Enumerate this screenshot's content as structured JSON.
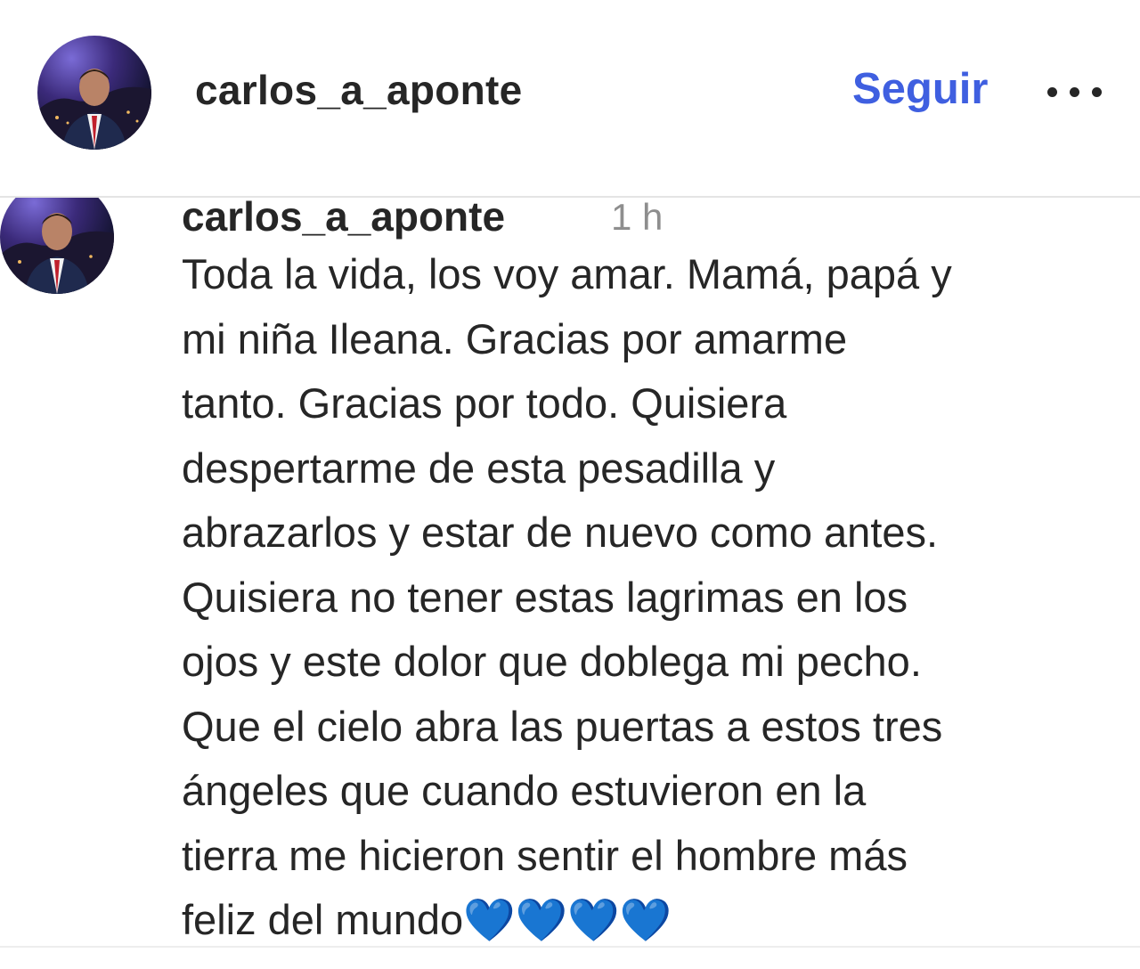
{
  "post_header": {
    "username": "carlos_a_aponte",
    "follow_label": "Seguir",
    "more_icon": "more-horizontal-icon"
  },
  "comment": {
    "username": "carlos_a_aponte",
    "time": "1 h",
    "text": "Toda la vida, los voy amar. Mamá, papá y\nmi niña Ileana. Gracias por amarme\ntanto. Gracias por todo. Quisiera\ndespertarme de esta pesadilla y\nabrazarlos y estar de nuevo como antes.\nQuisiera no tener estas lagrimas en los\nojos y este dolor que doblega mi pecho.\nQue el cielo abra las puertas a estos tres\nángeles que cuando estuvieron en la\ntierra me hicieron sentir el hombre más\nfeliz del mundo💙💙💙💙"
  },
  "colors": {
    "follow_link": "#3f5fe0",
    "text": "#262626",
    "timestamp": "#8e8e8e",
    "divider": "#e4e4e4"
  }
}
